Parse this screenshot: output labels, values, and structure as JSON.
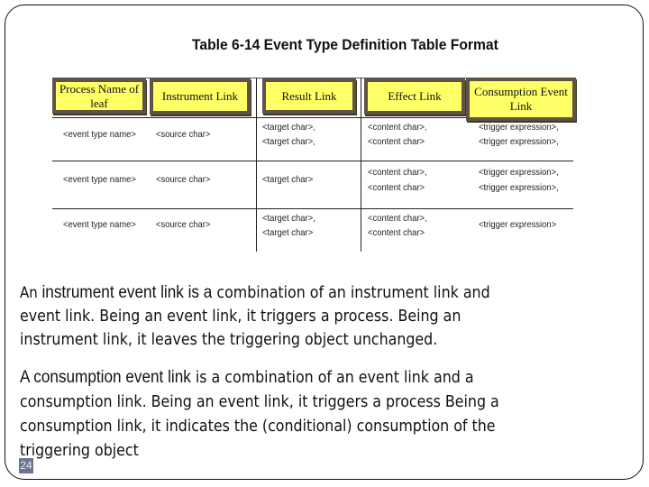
{
  "slide": {
    "table_title": "Table 6-14 Event Type Definition Table Format",
    "table": {
      "headers": [
        "Process Name of leaf",
        "Instrument Link",
        "Result Link",
        "Effect Link",
        "Consumption Event Link"
      ],
      "rows": [
        {
          "event_type": "<event type name>",
          "source": "<source char>",
          "result": [
            "<target char>,",
            "<target char>,"
          ],
          "effect": [
            "<content char>,",
            "<content char>"
          ],
          "consumption": [
            "<trigger expression>,",
            "<trigger expression>,"
          ]
        },
        {
          "event_type": "<event type name>",
          "source": "<source char>",
          "result": [
            "<target char>"
          ],
          "effect": [
            "<content char>,",
            "<content char>"
          ],
          "consumption": [
            "<trigger expression>,",
            "<trigger expression>,"
          ]
        },
        {
          "event_type": "<event type name>",
          "source": "<source char>",
          "result": [
            "<target char>,",
            "<target char>"
          ],
          "effect": [
            "<content char>,",
            "<content char>"
          ],
          "consumption": [
            "<trigger expression>"
          ]
        }
      ]
    },
    "paragraph1": {
      "prefix": "An ",
      "term": "instrument event  link is a",
      "lines": [
        " combination of an instrument link and",
        "event link. Being an event link, it triggers a process. Being an",
        "instrument link, it leaves the triggering object unchanged."
      ]
    },
    "paragraph2": {
      "term": "A consumption event link",
      "lines": [
        " is a combination of an event link and a",
        "consumption link. Being an event link, it triggers a process Being a",
        "consumption link, it indicates the (conditional) consumption of the",
        "triggering object"
      ]
    },
    "page_number": "24"
  }
}
